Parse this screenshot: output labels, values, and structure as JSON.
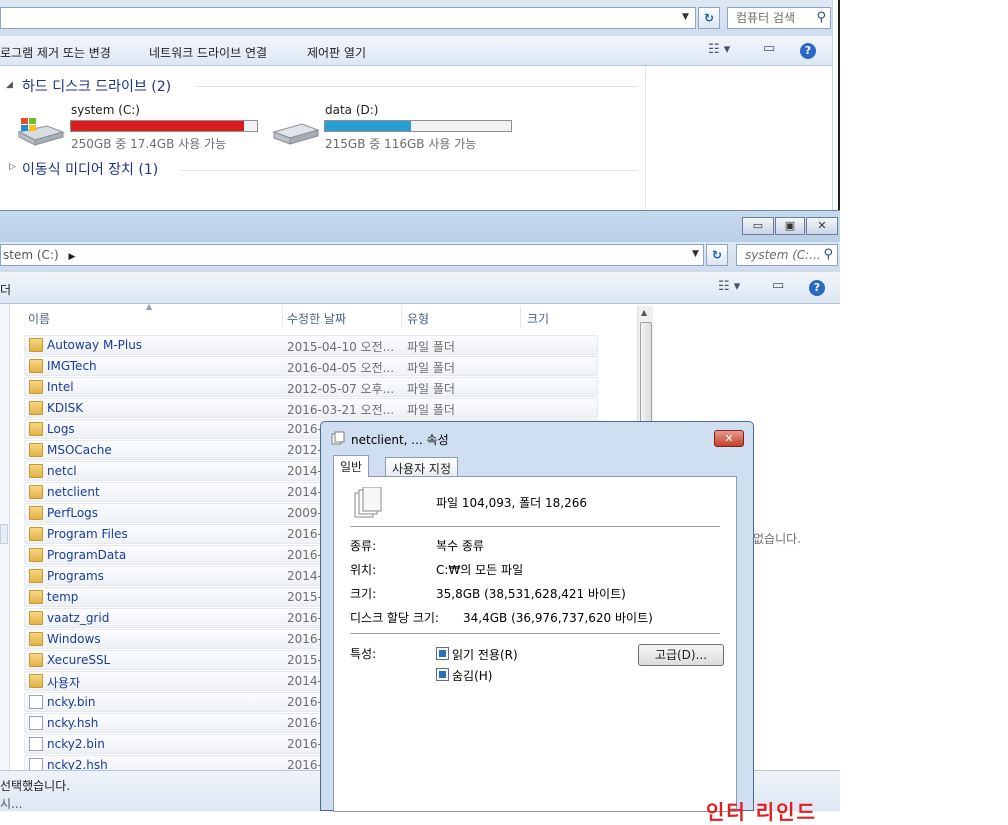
{
  "window1": {
    "search_placeholder": "컴퓨터 검색",
    "commands": [
      "로그램 제거 또는 변경",
      "네트워크 드라이브 연결",
      "제어판 열기"
    ],
    "groups": {
      "hdd": "하드 디스크 드라이브 (2)",
      "removable": "이동식 미디어 장치 (1)"
    },
    "drives": [
      {
        "name": "system (C:)",
        "info": "250GB 중 17.4GB 사용 가능",
        "used_fraction": 0.93,
        "bar_color": "#d81d1d"
      },
      {
        "name": "data (D:)",
        "info": "215GB 중 116GB 사용 가능",
        "used_fraction": 0.46,
        "bar_color": "#2a9fd3"
      }
    ]
  },
  "window2": {
    "breadcrumb": "stem (C:)",
    "search_placeholder": "system (C:...",
    "cmd_label": "더",
    "columns": {
      "name": "이름",
      "date": "수정한 날짜",
      "type": "유형",
      "size": "크기"
    },
    "rows": [
      {
        "name": "Autoway M-Plus",
        "date": "2015-04-10 오전...",
        "type": "파일 폴더",
        "kind": "folder"
      },
      {
        "name": "IMGTech",
        "date": "2016-04-05 오전...",
        "type": "파일 폴더",
        "kind": "folder"
      },
      {
        "name": "Intel",
        "date": "2012-05-07 오후...",
        "type": "파일 폴더",
        "kind": "folder"
      },
      {
        "name": "KDISK",
        "date": "2016-03-21 오전...",
        "type": "파일 폴더",
        "kind": "folder"
      },
      {
        "name": "Logs",
        "date": "2016-",
        "type": "",
        "kind": "folder"
      },
      {
        "name": "MSOCache",
        "date": "2012-",
        "type": "",
        "kind": "folder"
      },
      {
        "name": "netcl",
        "date": "2014-",
        "type": "",
        "kind": "folder"
      },
      {
        "name": "netclient",
        "date": "2014-",
        "type": "",
        "kind": "folder"
      },
      {
        "name": "PerfLogs",
        "date": "2009-",
        "type": "",
        "kind": "folder"
      },
      {
        "name": "Program Files",
        "date": "2016-",
        "type": "",
        "kind": "folder"
      },
      {
        "name": "ProgramData",
        "date": "2016-",
        "type": "",
        "kind": "folder"
      },
      {
        "name": "Programs",
        "date": "2014-",
        "type": "",
        "kind": "folder"
      },
      {
        "name": "temp",
        "date": "2015-",
        "type": "",
        "kind": "folder"
      },
      {
        "name": "vaatz_grid",
        "date": "2016-",
        "type": "",
        "kind": "folder"
      },
      {
        "name": "Windows",
        "date": "2016-",
        "type": "",
        "kind": "folder"
      },
      {
        "name": "XecureSSL",
        "date": "2015-",
        "type": "",
        "kind": "folder"
      },
      {
        "name": "사용자",
        "date": "2014-",
        "type": "",
        "kind": "folder"
      },
      {
        "name": "ncky.bin",
        "date": "2016-",
        "type": "",
        "kind": "file"
      },
      {
        "name": "ncky.hsh",
        "date": "2016-",
        "type": "",
        "kind": "file"
      },
      {
        "name": "ncky2.bin",
        "date": "2016-",
        "type": "",
        "kind": "file"
      },
      {
        "name": "ncky2.hsh",
        "date": "2016-",
        "type": "",
        "kind": "file"
      }
    ],
    "status_line1": "선택했습니다.",
    "status_line2": "시...",
    "side_message": "없습니다."
  },
  "dialog": {
    "title": "netclient, ... 속성",
    "tabs": [
      "일반",
      "사용자 지정"
    ],
    "summary": "파일 104,093, 폴더 18,266",
    "fields": [
      {
        "label": "종류:",
        "value": "복수 종류"
      },
      {
        "label": "위치:",
        "value": "C:₩의 모든 파일"
      },
      {
        "label": "크기:",
        "value": "35,8GB (38,531,628,421 바이트)"
      },
      {
        "label": "디스크 할당 크기:",
        "value": "34,4GB (36,976,737,620 바이트)"
      }
    ],
    "attributes_label": "특성:",
    "checkboxes": [
      "읽기 전용(R)",
      "숨김(H)"
    ],
    "advanced_button": "고급(D)..."
  },
  "bottom_red_text": "인터 리인드"
}
